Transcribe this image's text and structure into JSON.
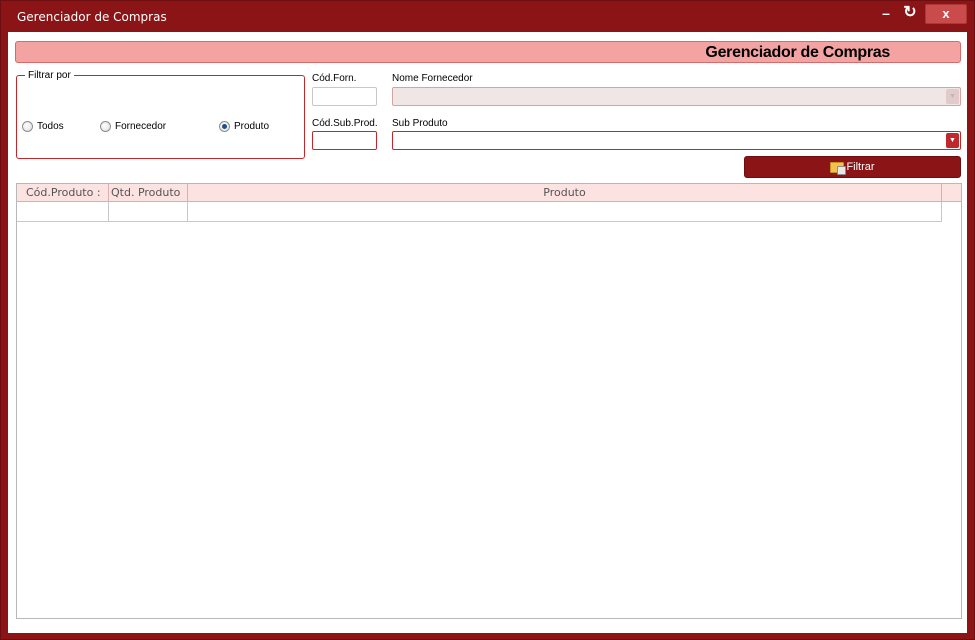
{
  "window": {
    "title": "Gerenciador de Compras",
    "controls": {
      "minimize": "–",
      "refresh": "↻",
      "close": "x"
    }
  },
  "header": {
    "title": "Gerenciador de Compras"
  },
  "filter": {
    "legend": "Filtrar por",
    "options": [
      {
        "label": "Todos",
        "checked": false
      },
      {
        "label": "Fornecedor",
        "checked": false
      },
      {
        "label": "Produto",
        "checked": true
      }
    ]
  },
  "fields": {
    "cod_forn_label": "Cód.Forn.",
    "cod_forn_value": "",
    "nome_fornecedor_label": "Nome Fornecedor",
    "nome_fornecedor_value": "",
    "cod_sub_prod_label": "Cód.Sub.Prod.",
    "cod_sub_prod_value": "",
    "sub_produto_label": "Sub Produto",
    "sub_produto_value": ""
  },
  "filter_button": {
    "label": "Filtrar",
    "icon": "folder-icon"
  },
  "grid": {
    "columns": [
      "Cód.Produto :",
      "Qtd. Produto",
      "Produto"
    ],
    "rows": [
      [
        "",
        "",
        ""
      ]
    ]
  },
  "colors": {
    "window_frame": "#8b1416",
    "header_bar": "#f4a3a3",
    "accent_border": "#c0282c",
    "grid_header": "#fde2e2"
  }
}
